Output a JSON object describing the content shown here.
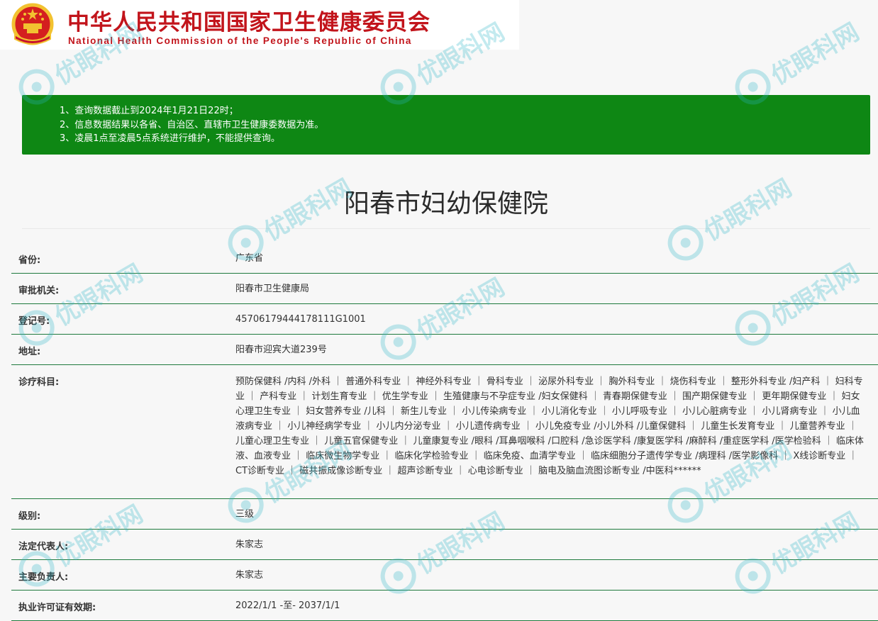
{
  "header": {
    "title_cn": "中华人民共和国国家卫生健康委员会",
    "title_en": "National Health Commission of the People's Republic of China"
  },
  "notice": [
    "1、查询数据截止到2024年1月21日22时；",
    "2、信息数据结果以各省、自治区、直辖市卫生健康委数据为准。",
    "3、凌晨1点至凌晨5点系统进行维护，不能提供查询。"
  ],
  "institution": {
    "name": "阳春市妇幼保健院"
  },
  "rows": [
    {
      "label": "省份:",
      "value": "广东省"
    },
    {
      "label": "审批机关:",
      "value": "阳春市卫生健康局"
    },
    {
      "label": "登记号:",
      "value": "45706179444178111G1001"
    },
    {
      "label": "地址:",
      "value": "阳春市迎宾大道239号"
    },
    {
      "label": "诊疗科目:",
      "value": "预防保健科 /内科 /外科 ｜ 普通外科专业 ｜ 神经外科专业 ｜ 骨科专业 ｜ 泌尿外科专业 ｜ 胸外科专业 ｜ 烧伤科专业 ｜ 整形外科专业 /妇产科 ｜ 妇科专业 ｜ 产科专业 ｜ 计划生育专业 ｜ 优生学专业 ｜ 生殖健康与不孕症专业 /妇女保健科 ｜ 青春期保健专业 ｜ 围产期保健专业 ｜ 更年期保健专业 ｜ 妇女心理卫生专业 ｜ 妇女营养专业 /儿科 ｜ 新生儿专业 ｜ 小儿传染病专业 ｜ 小儿消化专业 ｜ 小儿呼吸专业 ｜ 小儿心脏病专业 ｜ 小儿肾病专业 ｜ 小儿血液病专业 ｜ 小儿神经病学专业 ｜ 小儿内分泌专业 ｜ 小儿遗传病专业 ｜ 小儿免疫专业 /小儿外科 /儿童保健科 ｜ 儿童生长发育专业 ｜ 儿童营养专业 ｜ 儿童心理卫生专业 ｜ 儿童五官保健专业 ｜ 儿童康复专业 /眼科 /耳鼻咽喉科 /口腔科 /急诊医学科 /康复医学科 /麻醉科 /重症医学科 /医学检验科 ｜ 临床体液、血液专业 ｜ 临床微生物学专业 ｜ 临床化学检验专业 ｜ 临床免疫、血清学专业 ｜ 临床细胞分子遗传学专业 /病理科 /医学影像科 ｜ X线诊断专业 ｜ CT诊断专业 ｜ 磁共振成像诊断专业 ｜ 超声诊断专业 ｜ 心电诊断专业 ｜ 脑电及脑血流图诊断专业 /中医科******"
    },
    {
      "label": "级别:",
      "value": "三级"
    },
    {
      "label": "法定代表人:",
      "value": "朱家志"
    },
    {
      "label": "主要负责人:",
      "value": "朱家志"
    },
    {
      "label": "执业许可证有效期:",
      "value": "2022/1/1 -至- 2037/1/1"
    }
  ],
  "watermark_text": "优眼科网",
  "colors": {
    "brand_red": "#c2141b",
    "notice_green": "#0e8714",
    "row_rule": "#1f7a3d",
    "watermark": "#2bb6c8"
  }
}
